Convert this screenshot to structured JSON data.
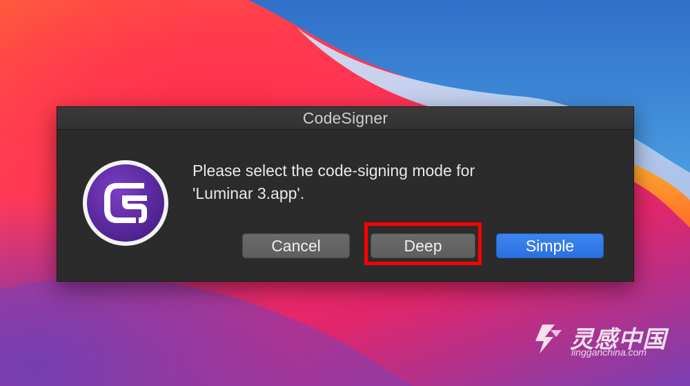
{
  "dialog": {
    "title": "CodeSigner",
    "message_line1": "Please select the code-signing mode for",
    "message_line2": "'Luminar 3.app'.",
    "app_icon": "codesigner-logo-icon",
    "buttons": {
      "cancel": "Cancel",
      "deep": "Deep",
      "simple": "Simple"
    },
    "default_button": "Simple",
    "highlighted_button": "Deep"
  },
  "watermark": {
    "brand": "灵感中国",
    "url": "lingganchina.com",
    "icon": "lingganchina-logo-icon"
  },
  "colors": {
    "dialog_bg": "#2b2b2b",
    "accent_blue": "#2a6fe0",
    "highlight_red": "#ff0000",
    "icon_purple": "#5a2a9e"
  }
}
